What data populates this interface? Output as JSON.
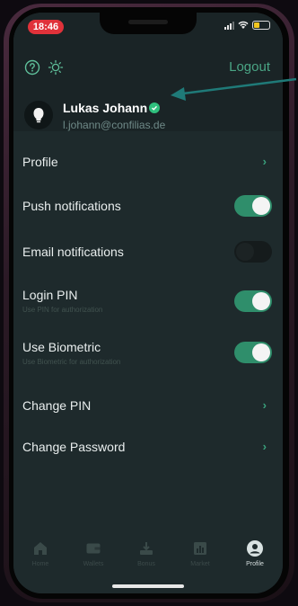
{
  "status_bar": {
    "time": "18:46"
  },
  "header": {
    "logout_label": "Logout",
    "help_icon": "help-circle-icon",
    "theme_icon": "sun-icon"
  },
  "user": {
    "name": "Lukas Johann",
    "email": "l.johann@confilias.de",
    "verified_color": "#2fbf7d"
  },
  "settings": [
    {
      "label": "Profile",
      "type": "link"
    },
    {
      "label": "Push notifications",
      "type": "toggle",
      "on": true
    },
    {
      "label": "Email notifications",
      "type": "toggle",
      "on": false
    },
    {
      "label": "Login PIN",
      "subtitle": "Use PIN for authorization",
      "type": "toggle",
      "on": true
    },
    {
      "label": "Use Biometric",
      "subtitle": "Use Biometric for authorization",
      "type": "toggle",
      "on": true
    },
    {
      "label": "Change PIN",
      "type": "link"
    },
    {
      "label": "Change Password",
      "type": "link"
    }
  ],
  "nav": [
    {
      "label": "Home",
      "icon": "home-icon"
    },
    {
      "label": "Wallets",
      "icon": "wallet-icon"
    },
    {
      "label": "Bonus",
      "icon": "bonus-icon"
    },
    {
      "label": "Market",
      "icon": "market-chart-icon"
    },
    {
      "label": "Profile",
      "icon": "profile-icon",
      "active": true
    }
  ],
  "colors": {
    "accent": "#2f8e6b",
    "background": "#1e2a2c",
    "header_background": "#1a2426",
    "annotation_arrow": "#1f7a78"
  }
}
